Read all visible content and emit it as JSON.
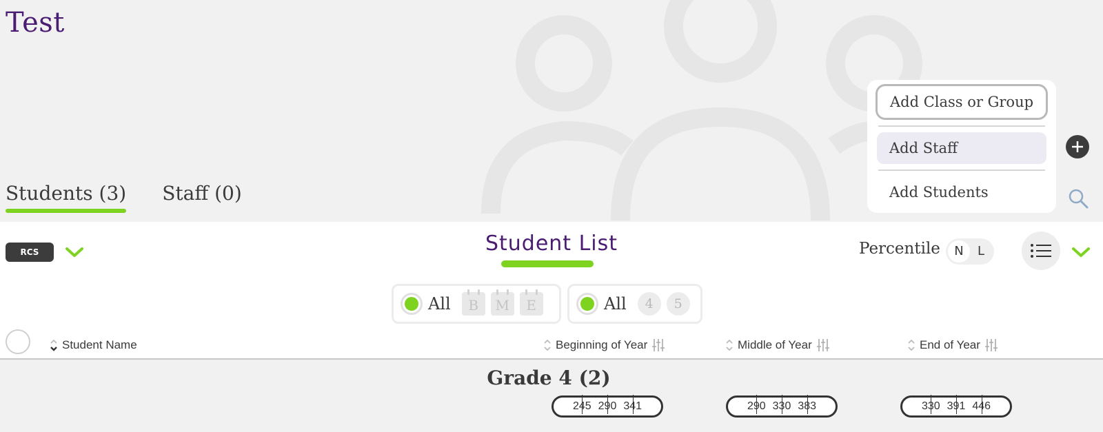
{
  "page": {
    "title": "Test"
  },
  "tabs": [
    {
      "label": "Students (3)",
      "active": true
    },
    {
      "label": "Staff (0)",
      "active": false
    }
  ],
  "add_menu": {
    "items": [
      {
        "label": "Add Class or Group"
      },
      {
        "label": "Add Staff"
      },
      {
        "label": "Add Students"
      }
    ]
  },
  "toolbar": {
    "badge": "RCS",
    "list_title": "Student List",
    "percentile_label": "Percentile",
    "norm_options": [
      "N",
      "L"
    ]
  },
  "filters": {
    "period": {
      "all_label": "All",
      "options": [
        "B",
        "M",
        "E"
      ]
    },
    "grade": {
      "all_label": "All",
      "options": [
        "4",
        "5"
      ]
    }
  },
  "table": {
    "columns": [
      {
        "label": "Student Name"
      },
      {
        "label": "Beginning of Year"
      },
      {
        "label": "Middle of Year"
      },
      {
        "label": "End of Year"
      }
    ]
  },
  "grades": [
    {
      "title": "Grade 4 (2)",
      "ranges": [
        [
          "245",
          "290",
          "341"
        ],
        [
          "290",
          "330",
          "383"
        ],
        [
          "330",
          "391",
          "446"
        ]
      ]
    }
  ],
  "colors": {
    "accent": "#7ed321",
    "title": "#4a1c72",
    "dark": "#3c3c3c"
  },
  "icons": [
    "plus-icon",
    "search-icon",
    "chevron-down-icon",
    "list-view-icon",
    "sort-icon",
    "filter-sliders-icon"
  ]
}
